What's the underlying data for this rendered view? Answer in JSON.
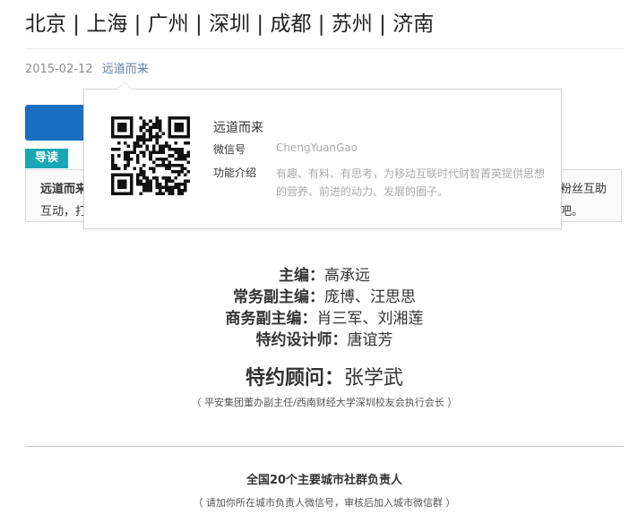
{
  "article": {
    "title": "北京 | 上海 | 广州 | 深圳 | 成都 | 苏州 | 济南",
    "date": "2015-02-12",
    "author": "远道而来"
  },
  "profile_popup": {
    "name": "远道而来",
    "wechat_label": "微信号",
    "wechat_id": "ChengYuanGao",
    "intro_label": "功能介绍",
    "intro_text": "有趣、有料、有思考，为移动互联时代财智菁英提供思想的营养、前进的动力、发展的圈子。"
  },
  "guide": {
    "tag": "导读",
    "line1_left": "远道而来",
    "line2_left": "互动，打",
    "line1_right": "粉丝互助",
    "line2_right": "吧。"
  },
  "credits": {
    "sep": "：",
    "editor_label": "主编",
    "editor_value": "高承远",
    "exec_label": "常务副主编",
    "exec_value": "庞博、汪思思",
    "biz_label": "商务副主编",
    "biz_value": "肖三军、刘湘莲",
    "designer_label": "特约设计师",
    "designer_value": "唐谊芳",
    "advisor_label": "特约顾问",
    "advisor_value": "张学武",
    "advisor_note": "（ 平安集团董办副主任/西南财经大学深圳校友会执行会长 ）"
  },
  "cities": {
    "heading": "全国20个主要城市社群负责人",
    "note": "（ 请加你所在城市负责人微信号，审核后加入城市微信群 ）"
  },
  "colors": {
    "link": "#607fa6",
    "guide_tag": "#1aa7b4",
    "banner": "#1a6fc2"
  }
}
